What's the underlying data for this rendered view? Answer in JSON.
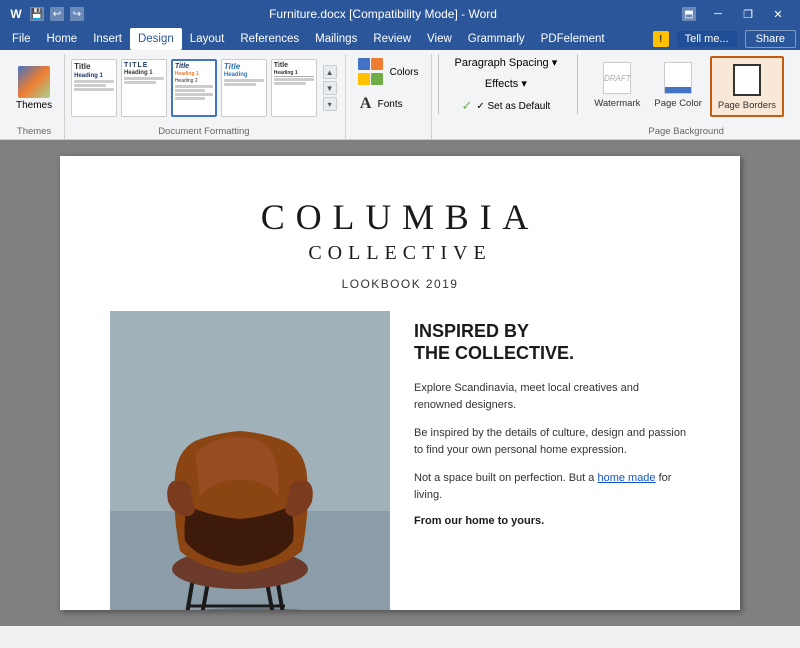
{
  "titleBar": {
    "appIcon": "W",
    "title": "Furniture.docx [Compatibility Mode] - Word",
    "windowControls": [
      "minimize",
      "restore",
      "close"
    ]
  },
  "menuBar": {
    "items": [
      "File",
      "Home",
      "Insert",
      "Design",
      "Layout",
      "References",
      "Mailings",
      "Review",
      "View",
      "Grammarly",
      "PDFelement"
    ]
  },
  "ribbon": {
    "activeTab": "Design",
    "tabs": [
      "File",
      "Home",
      "Insert",
      "Design",
      "Layout",
      "References",
      "Mailings",
      "Review",
      "View",
      "Grammarly",
      "PDFelement"
    ],
    "groups": {
      "themes": {
        "label": "Themes",
        "buttonLabel": "Themes"
      },
      "documentFormatting": {
        "label": "Document Formatting"
      },
      "colors": {
        "label": "Colors",
        "buttonLabel": "Colors"
      },
      "fonts": {
        "label": "Fonts",
        "buttonLabel": "Fonts"
      },
      "paragraphSpacing": {
        "label": "Paragraph Spacing ▾",
        "effects": "Effects ▾",
        "setDefault": "✓ Set as Default"
      },
      "pageBackground": {
        "label": "Page Background",
        "watermark": "Watermark",
        "pageColor": "Page Color",
        "pageBorders": "Page Borders"
      }
    },
    "tellMe": {
      "placeholder": "Tell me what you want to do..."
    },
    "shareLabel": "Share",
    "helpIcon": "?"
  },
  "document": {
    "titleMain": "COLUMBIA",
    "titleSub": "COLLECTIVE",
    "lookbook": "LOOKBOOK 2019",
    "headingBold": "INSPIRED BY\nTHE COLLECTIVE.",
    "paragraph1": "Explore Scandinavia, meet local creatives and renowned designers.",
    "paragraph2": "Be inspired by the details of culture, design and passion to find your own personal home expression.",
    "paragraph3Text1": "Not a space built on perfection. But a ",
    "paragraph3Link": "home made",
    "paragraph3Text2": " for living.",
    "paragraph4": "From our home to yours.",
    "imageAlt": "Brown leather chair"
  },
  "colors": {
    "accent1": "#4472c4",
    "accent2": "#ed7d31",
    "accent3": "#a9d18e",
    "accent4": "#ff0000",
    "accent5": "#ffc000",
    "accent6": "#70ad47"
  }
}
